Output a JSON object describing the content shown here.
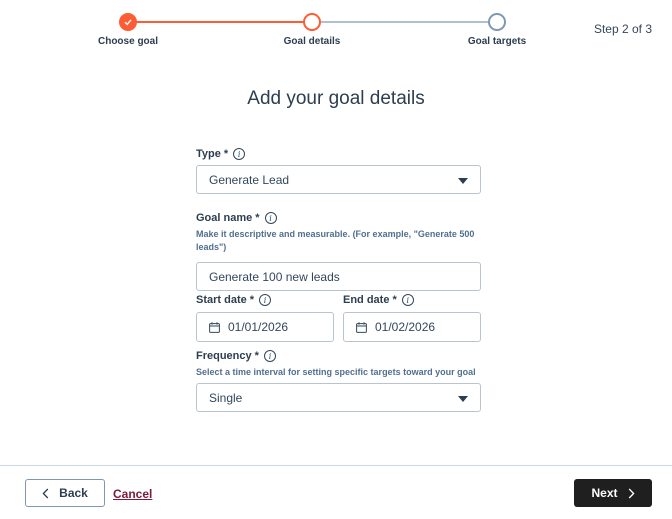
{
  "stepper": {
    "steps": [
      {
        "label": "Choose goal",
        "state": "completed"
      },
      {
        "label": "Goal details",
        "state": "current"
      },
      {
        "label": "Goal targets",
        "state": "pending"
      }
    ],
    "step_count": "Step 2 of 3",
    "accent_color": "#ff5c35"
  },
  "page_title": "Add your goal details",
  "form": {
    "type": {
      "label": "Type *",
      "value": "Generate Lead"
    },
    "goal_name": {
      "label": "Goal name *",
      "help": "Make it descriptive and measurable. (For example, \"Generate 500 leads\")",
      "value": "Generate 100 new leads"
    },
    "start_date": {
      "label": "Start date *",
      "value": "01/01/2026"
    },
    "end_date": {
      "label": "End date *",
      "value": "01/02/2026"
    },
    "frequency": {
      "label": "Frequency *",
      "help": "Select a time interval for setting specific targets toward your goal",
      "value": "Single"
    }
  },
  "footer": {
    "back_label": "Back",
    "cancel_label": "Cancel",
    "next_label": "Next"
  }
}
